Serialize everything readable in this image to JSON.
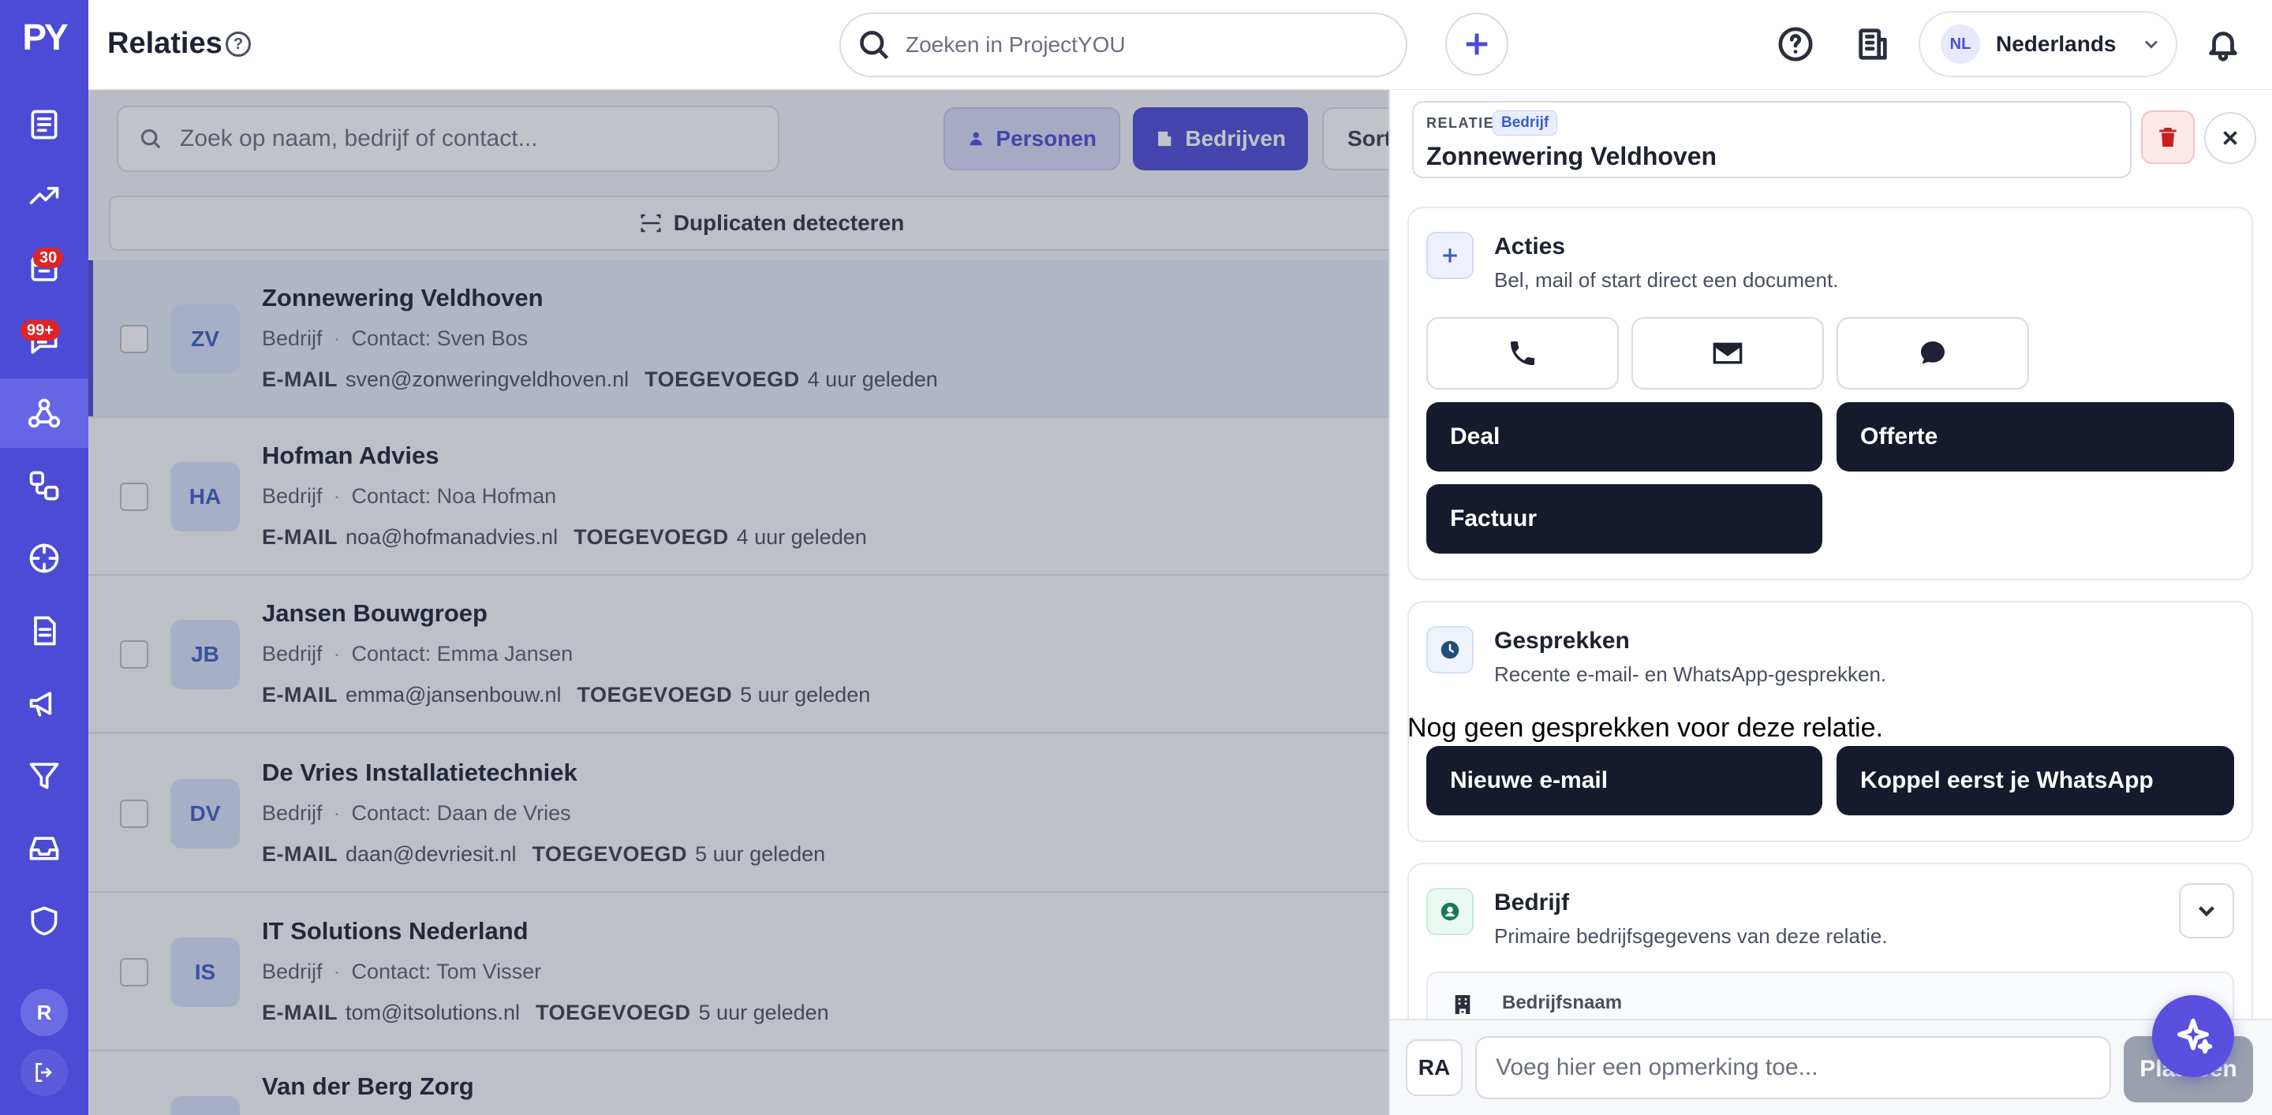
{
  "app": {
    "logo": "PY",
    "page_title": "Relaties",
    "search_placeholder": "Zoeken in ProjectYOU",
    "language_code": "NL",
    "language_name": "Nederlands"
  },
  "sidebar": {
    "items": [
      {
        "name": "tasks",
        "icon": "checklist-icon"
      },
      {
        "name": "trends",
        "icon": "trending-up-icon"
      },
      {
        "name": "calendar",
        "icon": "calendar-icon",
        "badge": "30"
      },
      {
        "name": "messages",
        "icon": "message-icon",
        "badge": "99+"
      },
      {
        "name": "relations",
        "icon": "network-icon",
        "active": true
      },
      {
        "name": "workflows",
        "icon": "flow-icon"
      },
      {
        "name": "targets",
        "icon": "crosshair-icon"
      },
      {
        "name": "documents",
        "icon": "document-icon"
      },
      {
        "name": "marketing",
        "icon": "megaphone-icon"
      },
      {
        "name": "funnel",
        "icon": "filter-icon"
      },
      {
        "name": "inbox",
        "icon": "inbox-icon"
      },
      {
        "name": "security",
        "icon": "shield-icon"
      }
    ],
    "user_initial": "R"
  },
  "list": {
    "search_placeholder": "Zoek op naam, bedrijf of contact...",
    "filters": {
      "persons": "Personen",
      "companies": "Bedrijven",
      "sort": "Sort"
    },
    "duplicates_label": "Duplicaten detecteren",
    "email_label": "E-MAIL",
    "added_label": "TOEGEVOEGD",
    "rows": [
      {
        "initials": "ZV",
        "name": "Zonnewering Veldhoven",
        "type": "Bedrijf",
        "contact": "Contact: Sven Bos",
        "email": "sven@zonweringveldhoven.nl",
        "added": "4 uur geleden"
      },
      {
        "initials": "HA",
        "name": "Hofman Advies",
        "type": "Bedrijf",
        "contact": "Contact: Noa Hofman",
        "email": "noa@hofmanadvies.nl",
        "added": "4 uur geleden"
      },
      {
        "initials": "JB",
        "name": "Jansen Bouwgroep",
        "type": "Bedrijf",
        "contact": "Contact: Emma Jansen",
        "email": "emma@jansenbouw.nl",
        "added": "5 uur geleden"
      },
      {
        "initials": "DV",
        "name": "De Vries Installatietechniek",
        "type": "Bedrijf",
        "contact": "Contact: Daan de Vries",
        "email": "daan@devriesit.nl",
        "added": "5 uur geleden"
      },
      {
        "initials": "IS",
        "name": "IT Solutions Nederland",
        "type": "Bedrijf",
        "contact": "Contact: Tom Visser",
        "email": "tom@itsolutions.nl",
        "added": "5 uur geleden"
      },
      {
        "initials": "",
        "name": "Van der Berg Zorg",
        "type": "",
        "contact": "",
        "email": "",
        "added": ""
      }
    ]
  },
  "panel": {
    "label": "RELATIE",
    "chip": "Bedrijf",
    "title": "Zonnewering Veldhoven",
    "actions": {
      "title": "Acties",
      "subtitle": "Bel, mail of start direct een document.",
      "deal": "Deal",
      "offerte": "Offerte",
      "factuur": "Factuur"
    },
    "conversations": {
      "title": "Gesprekken",
      "subtitle": "Recente e-mail- en WhatsApp-gesprekken.",
      "empty": "Nog geen gesprekken voor deze relatie.",
      "new_email": "Nieuwe e-mail",
      "whatsapp": "Koppel eerst je WhatsApp"
    },
    "company": {
      "title": "Bedrijf",
      "subtitle": "Primaire bedrijfsgegevens van deze relatie.",
      "field_label": "Bedrijfsnaam"
    },
    "comment": {
      "avatar": "RA",
      "placeholder": "Voeg hier een opmerking toe...",
      "post": "Plaatsen"
    }
  }
}
